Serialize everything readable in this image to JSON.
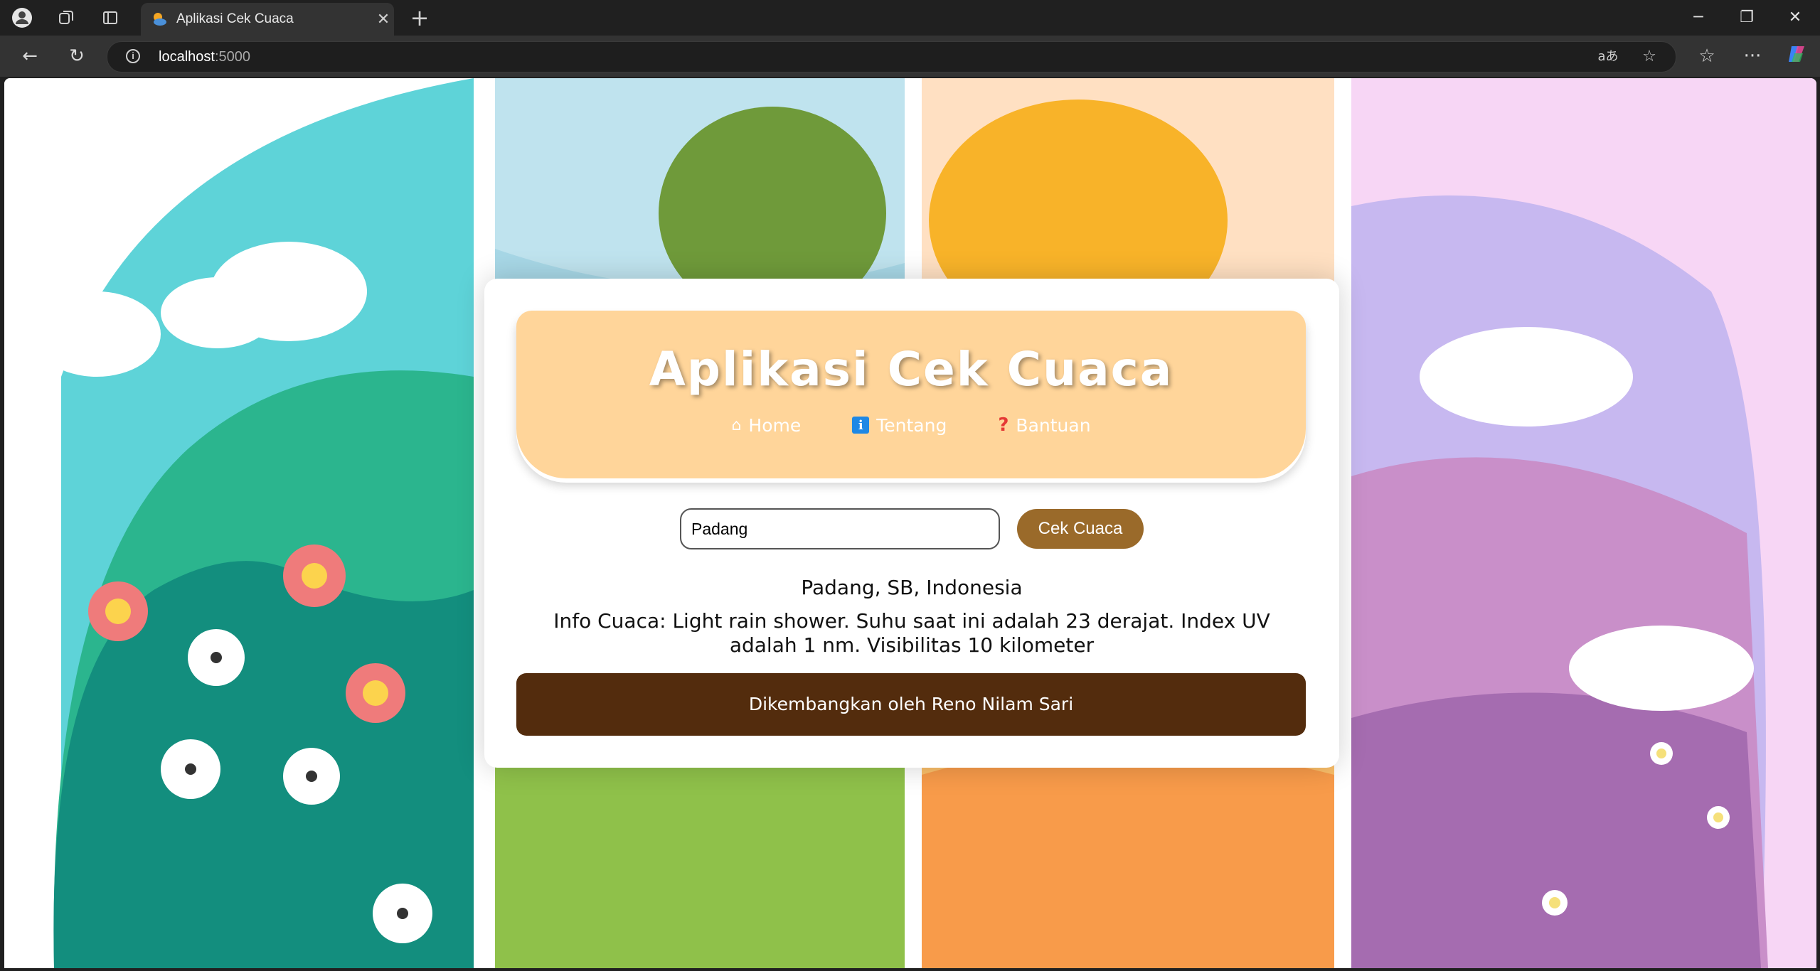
{
  "browser": {
    "tab_title": "Aplikasi Cek Cuaca",
    "url_host": "localhost",
    "url_port": ":5000",
    "icons": [
      "profile-icon",
      "workspaces-icon",
      "tab-actions-icon",
      "close-icon",
      "new-tab-icon",
      "minimize-icon",
      "restore-icon",
      "window-close-icon",
      "back-icon",
      "refresh-icon",
      "info-icon",
      "read-aloud-icon",
      "favorite-star-icon",
      "favorites-icon",
      "more-icon",
      "copilot-icon"
    ]
  },
  "app": {
    "title": "Aplikasi Cek Cuaca",
    "nav": [
      {
        "label": "Home",
        "icon": "home-icon"
      },
      {
        "label": "Tentang",
        "icon": "info-icon"
      },
      {
        "label": "Bantuan",
        "icon": "question-icon"
      }
    ],
    "search": {
      "value": "Padang",
      "button_label": "Cek Cuaca"
    },
    "result": {
      "location": "Padang, SB, Indonesia",
      "info": "Info Cuaca: Light rain shower. Suhu saat ini adalah 23 derajat. Index UV adalah 1 nm. Visibilitas 10 kilometer"
    },
    "footer": "Dikembangkan oleh Reno Nilam Sari"
  },
  "colors": {
    "header_bg": "#ffd59a",
    "button_bg": "#9a6a2a",
    "footer_bg": "#532c0d"
  }
}
